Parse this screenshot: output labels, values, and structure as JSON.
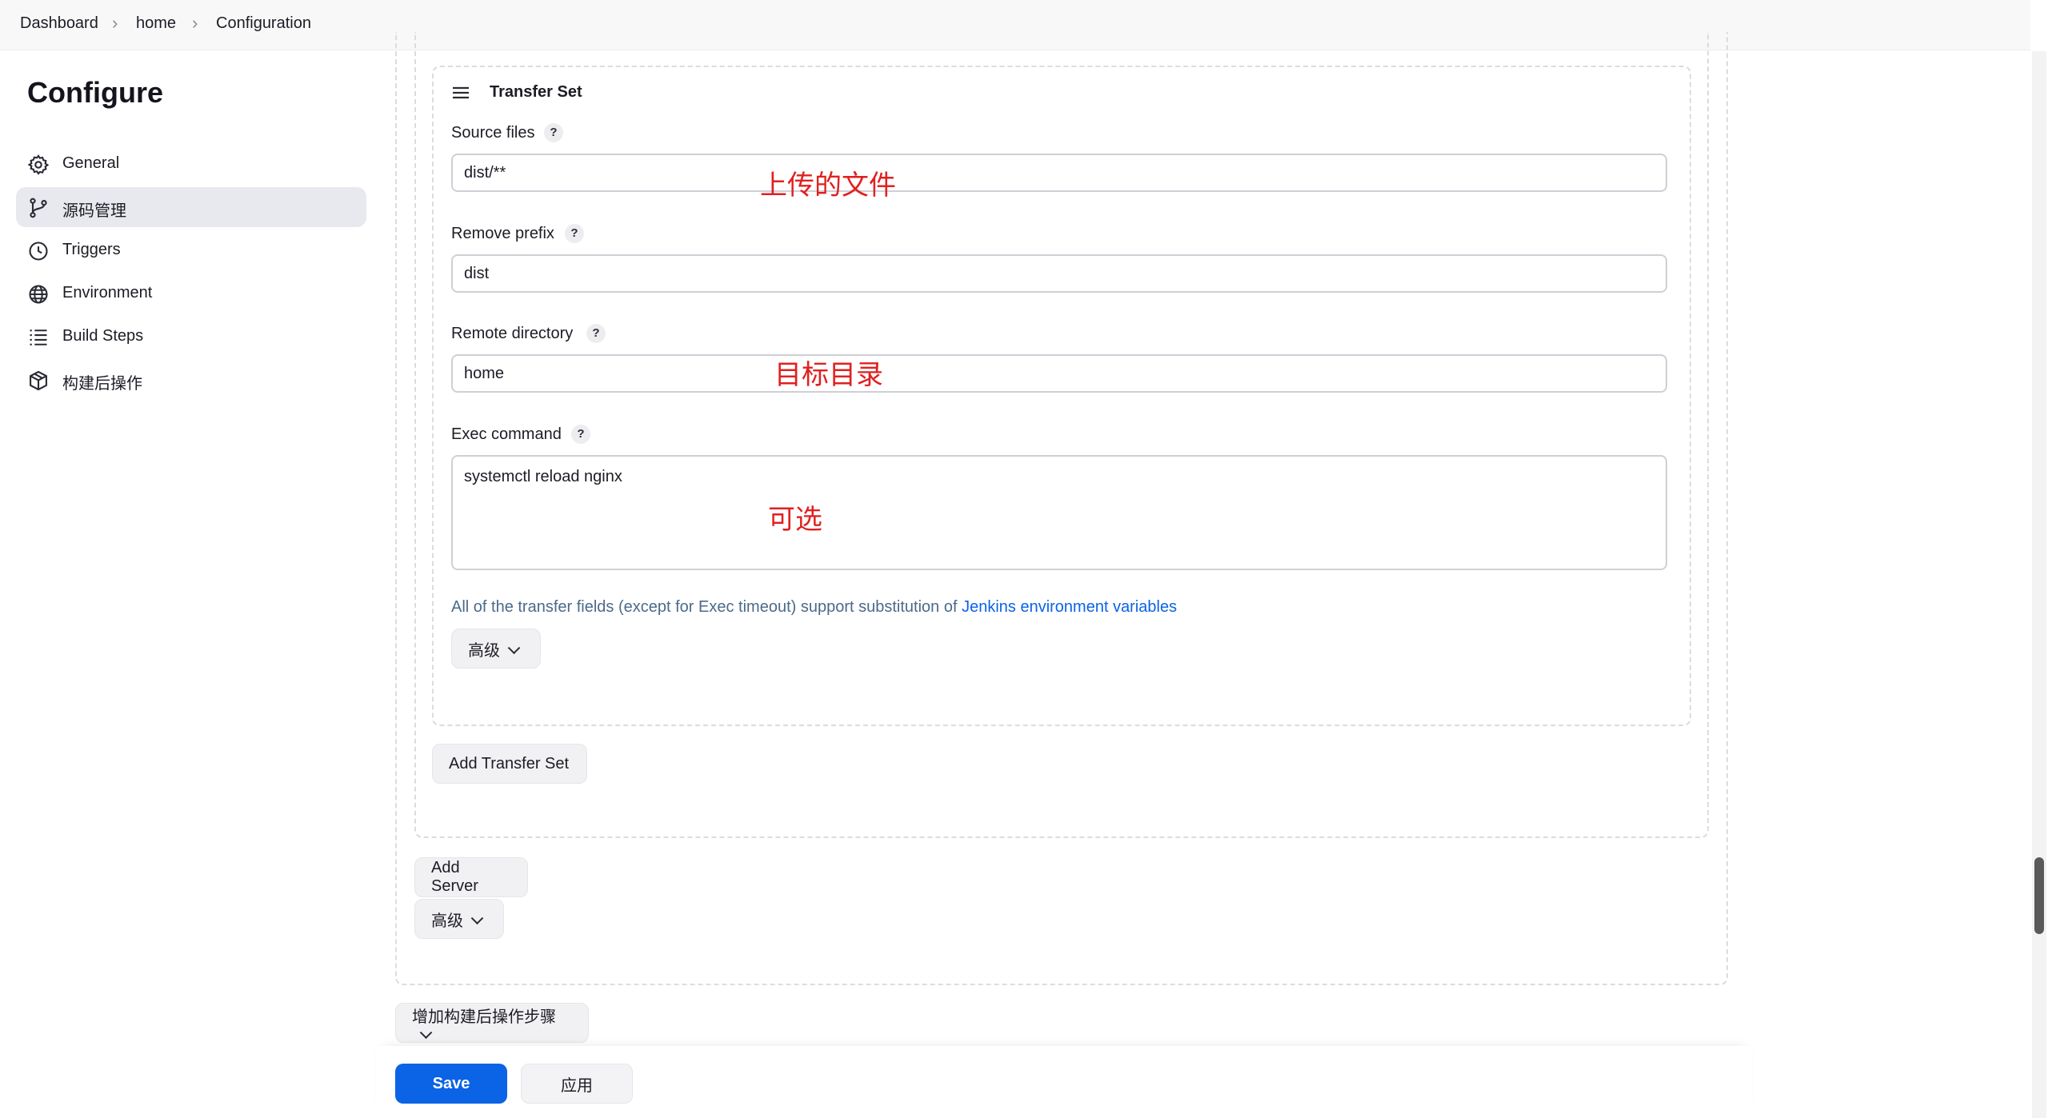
{
  "breadcrumb": [
    "Dashboard",
    "home",
    "Configuration"
  ],
  "sidebar": {
    "title": "Configure",
    "items": [
      {
        "label": "General",
        "icon": "gear-icon"
      },
      {
        "label": "源码管理",
        "icon": "branch-icon",
        "active": true
      },
      {
        "label": "Triggers",
        "icon": "clock-icon"
      },
      {
        "label": "Environment",
        "icon": "globe-icon"
      },
      {
        "label": "Build Steps",
        "icon": "list-icon"
      },
      {
        "label": "构建后操作",
        "icon": "package-icon"
      }
    ]
  },
  "transfer_set": {
    "title": "Transfer Set",
    "source_files": {
      "label": "Source files",
      "value": "dist/**"
    },
    "remove_prefix": {
      "label": "Remove prefix",
      "value": "dist"
    },
    "remote_directory": {
      "label": "Remote directory",
      "value": "home"
    },
    "exec_command": {
      "label": "Exec command",
      "value": "systemctl reload nginx"
    },
    "help_glyph": "?",
    "note_text": "All of the transfer fields (except for Exec timeout) support substitution of ",
    "note_link": "Jenkins environment variables",
    "advanced_label": "高级"
  },
  "annotations": {
    "source": "上传的文件",
    "remote": "目标目录",
    "exec": "可选"
  },
  "buttons": {
    "add_transfer_set": "Add Transfer Set",
    "add_server": "Add Server",
    "server_advanced": "高级",
    "add_post_build_step": "增加构建后操作步骤",
    "save": "Save",
    "apply": "应用"
  },
  "colors": {
    "primary": "#0b63e5",
    "link": "#0b63e5",
    "annotation": "#e02020",
    "active_nav_bg": "#e8e9ee"
  }
}
